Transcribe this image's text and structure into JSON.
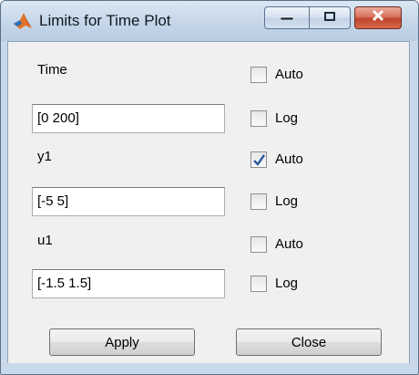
{
  "window": {
    "title": "Limits for Time Plot",
    "app_icon": "matlab-icon",
    "buttons": {
      "minimize_icon": "minimize-icon",
      "maximize_icon": "maximize-icon",
      "close_icon": "close-icon"
    }
  },
  "rows": [
    {
      "label": "Time",
      "value": "[0 200]",
      "auto": {
        "label": "Auto",
        "checked": false
      },
      "log": {
        "label": "Log",
        "checked": false
      }
    },
    {
      "label": "y1",
      "value": "[-5 5]",
      "auto": {
        "label": "Auto",
        "checked": true
      },
      "log": {
        "label": "Log",
        "checked": false
      }
    },
    {
      "label": "u1",
      "value": "[-1.5 1.5]",
      "auto": {
        "label": "Auto",
        "checked": false
      },
      "log": {
        "label": "Log",
        "checked": false
      }
    }
  ],
  "actions": {
    "apply_label": "Apply",
    "close_label": "Close"
  },
  "colors": {
    "frame": "#c9d9ea",
    "panel": "#f0f0f0",
    "close_button": "#c0432b",
    "check": "#2c5aa0"
  }
}
